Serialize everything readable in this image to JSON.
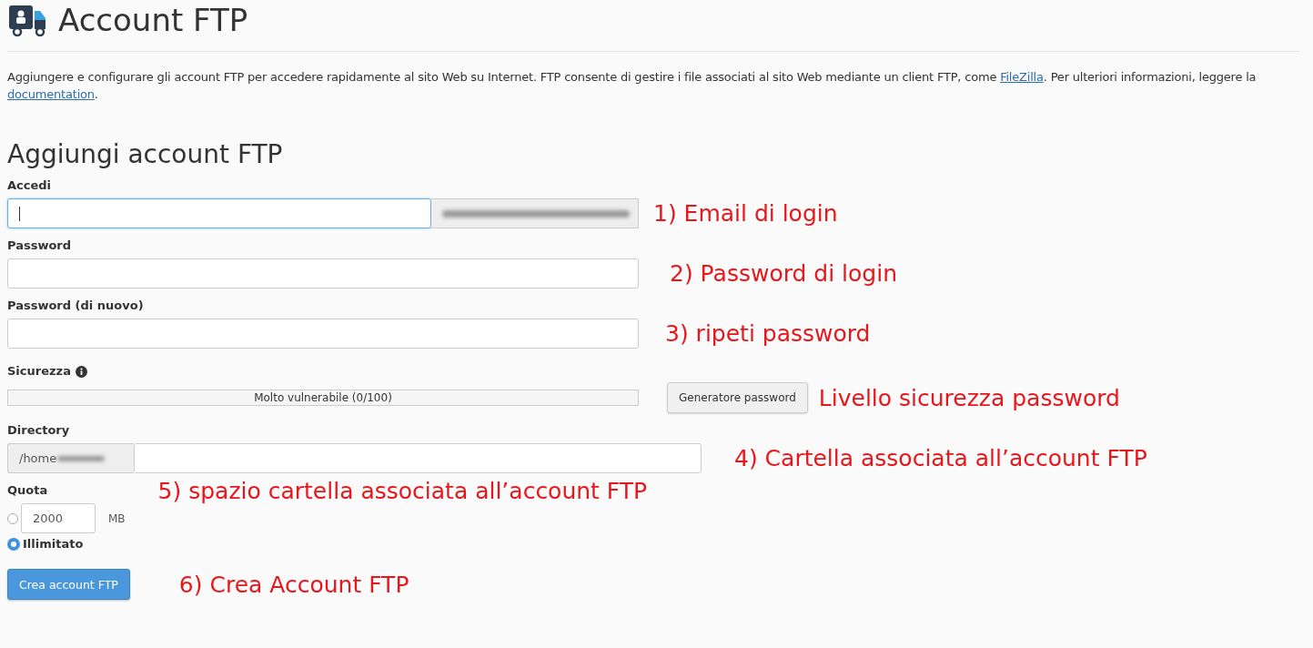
{
  "header": {
    "title": "Account FTP"
  },
  "description": [
    {
      "kind": "text",
      "text": "Aggiungere e configurare gli account FTP per accedere rapidamente al sito Web su Internet. FTP consente di gestire i file associati al sito Web mediante un client FTP, come "
    },
    {
      "kind": "link",
      "text": "FileZilla"
    },
    {
      "kind": "text",
      "text": ". Per ulteriori informazioni, leggere la "
    },
    {
      "kind": "link",
      "text": "documentation"
    },
    {
      "kind": "text",
      "text": "."
    }
  ],
  "form": {
    "title": "Aggiungi account FTP",
    "login": {
      "label": "Accedi",
      "focused": true,
      "annotation": "1) Email di login"
    },
    "password": {
      "label": "Password",
      "annotation": "2) Password di login"
    },
    "password_again": {
      "label": "Password (di nuovo)",
      "annotation": "3) ripeti password"
    },
    "strength": {
      "label": "Sicurezza",
      "level": 0,
      "reading": "Molto vulnerabile (0/100)",
      "generator_button": "Generatore password",
      "annotation": "Livello sicurezza password"
    },
    "directory": {
      "label": "Directory",
      "prefix": "/home",
      "annotation": "4) Cartella associata all’account FTP"
    },
    "quota": {
      "label": "Quota",
      "annotation": "5) spazio cartella associata all’account FTP",
      "options": [
        {
          "kind": "amount",
          "value": "2000",
          "unit": "MB",
          "selected": false
        },
        {
          "kind": "unlimited",
          "label": "Illimitato",
          "selected": true
        }
      ]
    },
    "submit": {
      "label": "Crea account FTP",
      "annotation": "6) Crea Account FTP"
    }
  }
}
